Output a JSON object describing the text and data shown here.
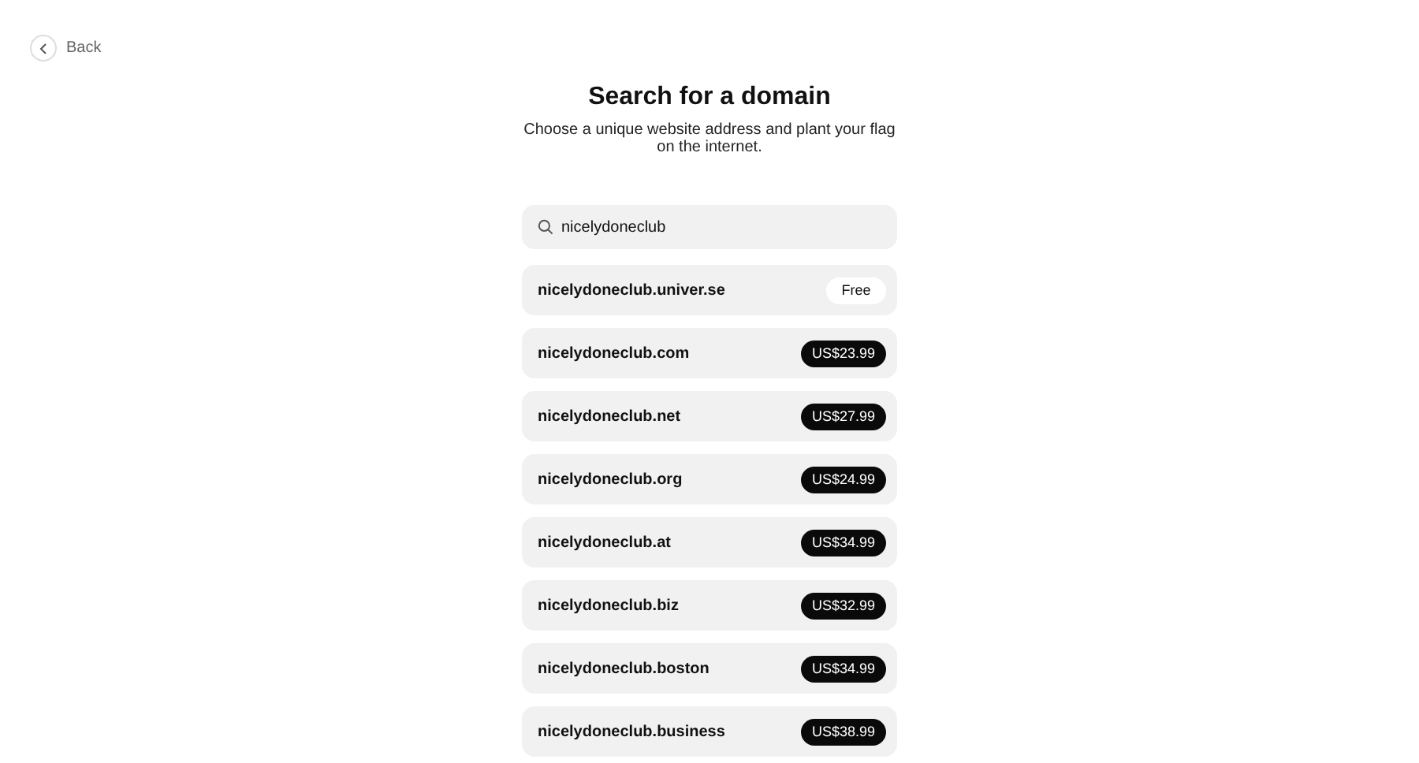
{
  "back": {
    "label": "Back"
  },
  "title": "Search for a domain",
  "subtitle": "Choose a unique website address and plant your flag on the internet.",
  "search": {
    "value": "nicelydoneclub"
  },
  "results": [
    {
      "domain": "nicelydoneclub.univer.se",
      "price": "Free",
      "kind": "free"
    },
    {
      "domain": "nicelydoneclub.com",
      "price": "US$23.99",
      "kind": "paid"
    },
    {
      "domain": "nicelydoneclub.net",
      "price": "US$27.99",
      "kind": "paid"
    },
    {
      "domain": "nicelydoneclub.org",
      "price": "US$24.99",
      "kind": "paid"
    },
    {
      "domain": "nicelydoneclub.at",
      "price": "US$34.99",
      "kind": "paid"
    },
    {
      "domain": "nicelydoneclub.biz",
      "price": "US$32.99",
      "kind": "paid"
    },
    {
      "domain": "nicelydoneclub.boston",
      "price": "US$34.99",
      "kind": "paid"
    },
    {
      "domain": "nicelydoneclub.business",
      "price": "US$38.99",
      "kind": "paid"
    }
  ]
}
